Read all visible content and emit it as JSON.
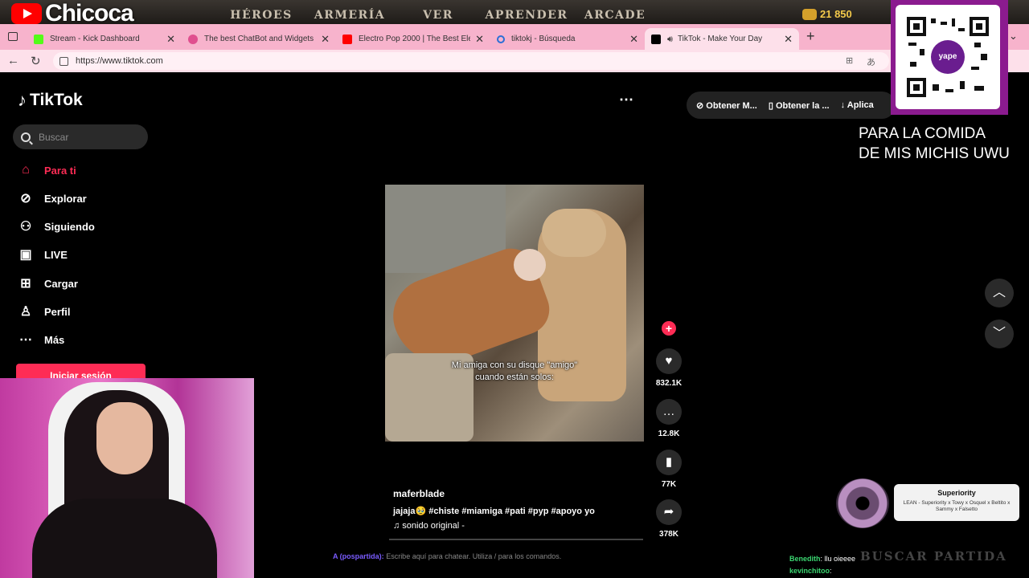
{
  "game": {
    "channel": "Chicoca",
    "menu": [
      "HÉROES",
      "ARMERÍA",
      "VER",
      "APRENDER",
      "ARCADE"
    ],
    "coins": "21 850",
    "lobby_button": "BUSCAR PARTIDA"
  },
  "browser": {
    "tabs": [
      {
        "title": "Stream - Kick Dashboard",
        "color": "#53fc18"
      },
      {
        "title": "The best ChatBot and Widgets for",
        "color": "#e04f8f"
      },
      {
        "title": "Electro Pop 2000 | The Best Electr",
        "color": "#ff0000"
      },
      {
        "title": "tiktokj - Búsqueda",
        "color": "#2b6fd6"
      },
      {
        "title": "TikTok - Make Your Day",
        "color": "#000000"
      }
    ],
    "url": "https://www.tiktok.com"
  },
  "tiktok": {
    "brand": "TikTok",
    "search_placeholder": "Buscar",
    "nav": [
      {
        "label": "Para ti",
        "icon": "home-icon",
        "active": true
      },
      {
        "label": "Explorar",
        "icon": "compass-icon"
      },
      {
        "label": "Siguiendo",
        "icon": "following-icon"
      },
      {
        "label": "LIVE",
        "icon": "live-icon"
      },
      {
        "label": "Cargar",
        "icon": "upload-icon"
      },
      {
        "label": "Perfil",
        "icon": "profile-icon"
      },
      {
        "label": "Más",
        "icon": "more-icon"
      }
    ],
    "login": "Iniciar sesión",
    "get_bar": [
      "Obtener M...",
      "Obtener la ...",
      "Aplica"
    ],
    "video": {
      "caption_line1": "Mi amiga con su disque \"amigo\"",
      "caption_line2": "cuando están solos:",
      "author": "maferblade",
      "description": "jajaja🥹 #chiste #miamiga #pati #pyp #apoyo yo",
      "sound": "♫ sonido original -",
      "likes": "832.1K",
      "comments": "12.8K",
      "saves": "77K",
      "shares": "378K"
    }
  },
  "overlay": {
    "qr_label": "yape",
    "donation_text_1": "PARA LA COMIDA",
    "donation_text_2": "DE MIS MICHIS UWU",
    "now_playing_title": "Superiority",
    "now_playing_artists": "LEAN - Superiority x Towy x Osquel x Beltito x Sammy x Falsetto",
    "chat_prefix": "A (pospartida):",
    "chat_hint": "Escribe aquí para chatear. Utiliza / para los comandos.",
    "chat_lines": [
      {
        "user": "Benedith",
        "msg": "llu oieeee"
      },
      {
        "user": "kevinchitoo",
        "msg": ""
      }
    ]
  }
}
